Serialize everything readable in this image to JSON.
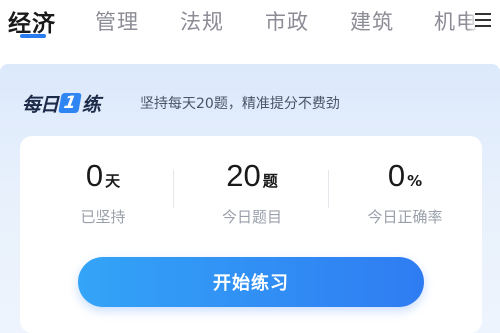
{
  "tabs": [
    {
      "label": "经济",
      "active": true
    },
    {
      "label": "管理",
      "active": false
    },
    {
      "label": "法规",
      "active": false
    },
    {
      "label": "市政",
      "active": false
    },
    {
      "label": "建筑",
      "active": false
    },
    {
      "label": "机电",
      "active": false
    }
  ],
  "menu_icon": "hamburger-menu-icon",
  "daily": {
    "brand_prefix": "每日",
    "brand_number": "1",
    "brand_suffix": "练",
    "slogan": "坚持每天20题，精准提分不费劲"
  },
  "stats": [
    {
      "value": "0",
      "unit": "天",
      "label": "已坚持"
    },
    {
      "value": "20",
      "unit": "题",
      "label": "今日题目"
    },
    {
      "value": "0",
      "unit": "%",
      "label": "今日正确率"
    }
  ],
  "start_button": "开始练习",
  "colors": {
    "accent": "#2b7bf0",
    "button_start": "#33a4f7",
    "button_end": "#2f7cf2",
    "section_bg": "#dce9fb"
  }
}
